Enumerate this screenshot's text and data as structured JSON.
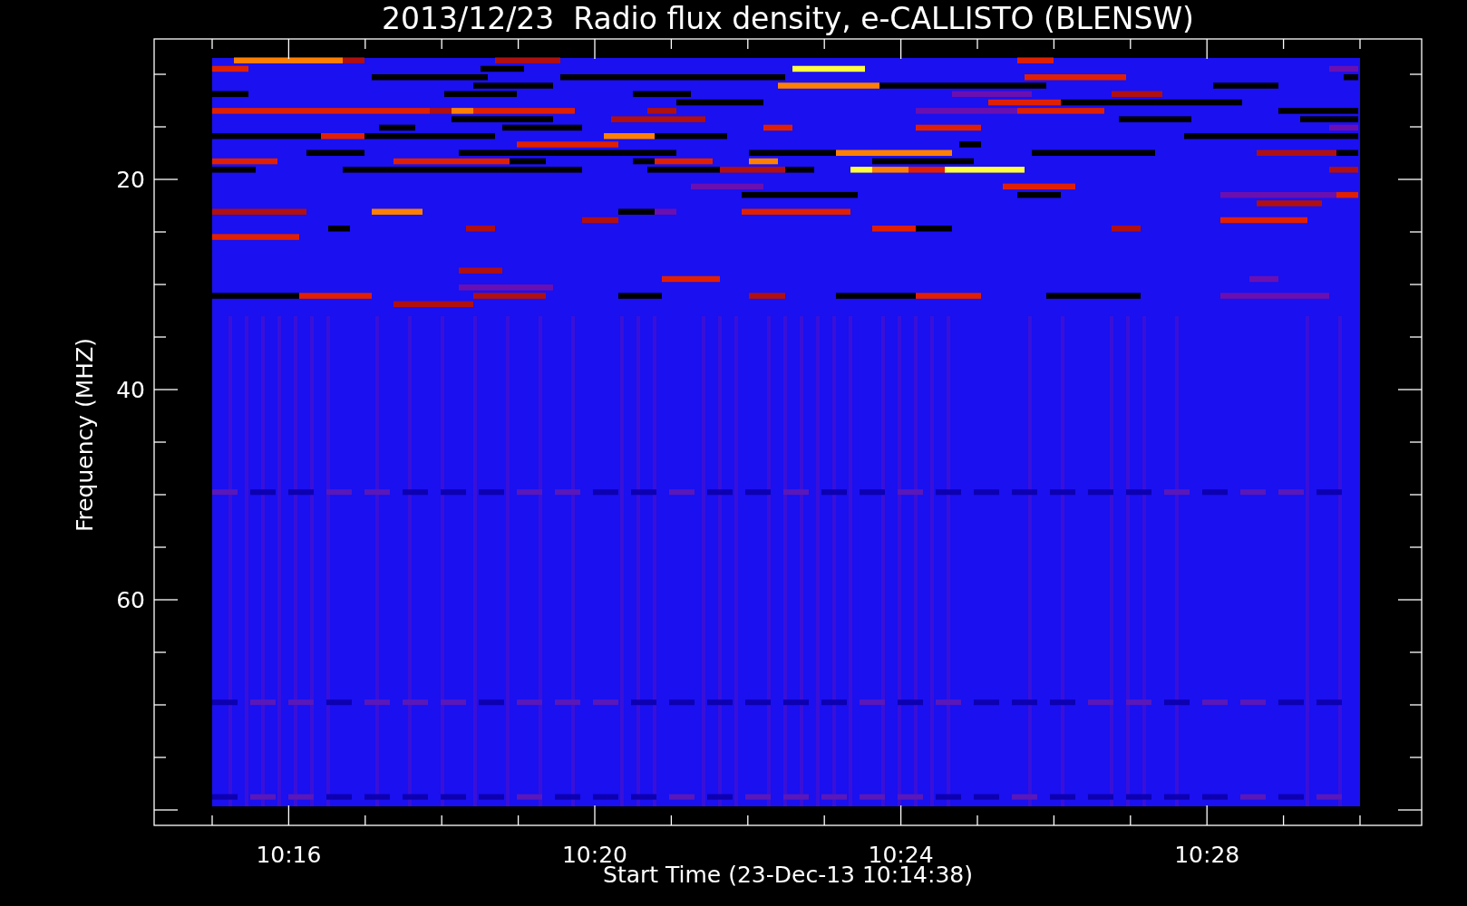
{
  "plot": {
    "title": "2013/12/23  Radio flux density, e-CALLISTO (BLENSW)",
    "x_axis": {
      "label": "Start Time (23-Dec-13 10:14:38)",
      "ticks": [
        {
          "label": "10:16"
        },
        {
          "label": "10:20"
        },
        {
          "label": "10:24"
        },
        {
          "label": "10:28"
        }
      ]
    },
    "y_axis": {
      "label": "Frequency (MHZ)",
      "ticks": [
        {
          "label": "20"
        },
        {
          "label": "40"
        },
        {
          "label": "60"
        }
      ]
    }
  }
}
